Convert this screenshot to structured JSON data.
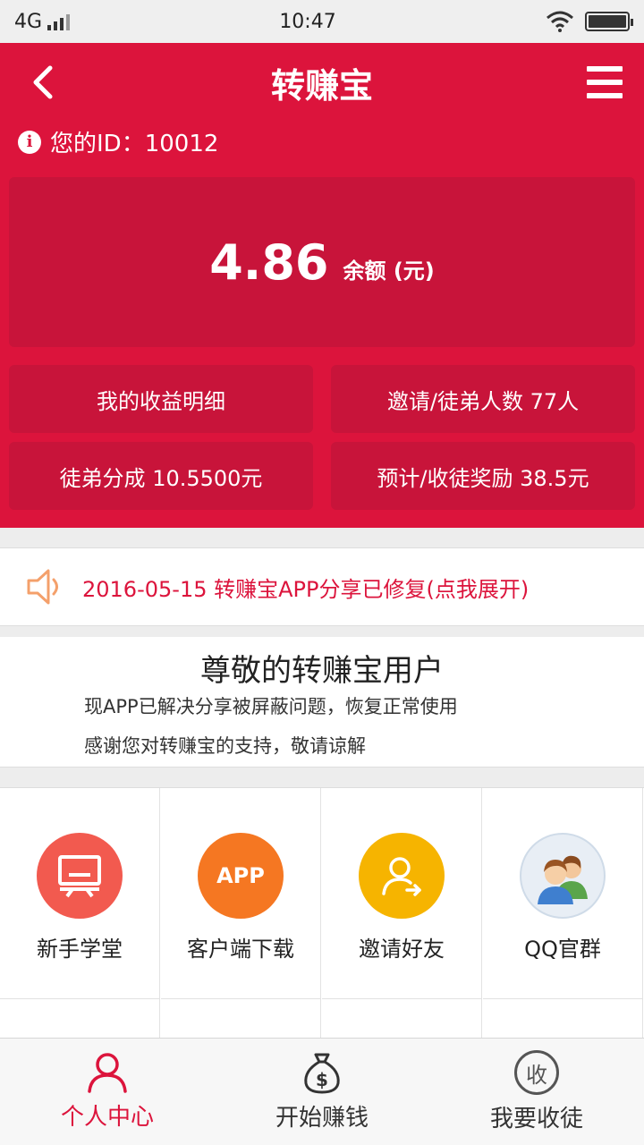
{
  "status_bar": {
    "network": "4G",
    "time": "10:47"
  },
  "header": {
    "title": "转赚宝"
  },
  "account": {
    "id_text": "您的ID：10012"
  },
  "balance": {
    "value": "4.86",
    "label": "余额 (元)"
  },
  "stats": [
    {
      "label": "我的收益明细"
    },
    {
      "label": "邀请/徒弟人数 77人"
    },
    {
      "label": "徒弟分成 10.5500元"
    },
    {
      "label": "预计/收徒奖励 38.5元"
    }
  ],
  "notice": {
    "text": "2016-05-15 转赚宝APP分享已修复(点我展开)"
  },
  "message": {
    "title": "尊敬的转赚宝用户",
    "line1": "现APP已解决分享被屏蔽问题，恢复正常使用",
    "line2": "感谢您对转赚宝的支持，敬请谅解"
  },
  "grid": [
    {
      "label": "新手学堂",
      "icon": "monitor-icon",
      "color": "#f25a4f"
    },
    {
      "label": "客户端下载",
      "icon": "app-icon",
      "color": "#f57722",
      "icon_text": "APP"
    },
    {
      "label": "邀请好友",
      "icon": "invite-user-icon",
      "color": "#f6b400"
    },
    {
      "label": "QQ官群",
      "icon": "qq-group-icon",
      "color": "#6fa3d8"
    }
  ],
  "tabbar": {
    "tabs": [
      {
        "label": "个人中心",
        "icon": "user-icon",
        "active": true
      },
      {
        "label": "开始赚钱",
        "icon": "money-bag-icon",
        "active": false
      },
      {
        "label": "我要收徒",
        "icon": "collect-icon",
        "icon_text": "收",
        "active": false
      }
    ]
  },
  "colors": {
    "brand": "#dc143c",
    "brand_dark": "#c8143a"
  }
}
